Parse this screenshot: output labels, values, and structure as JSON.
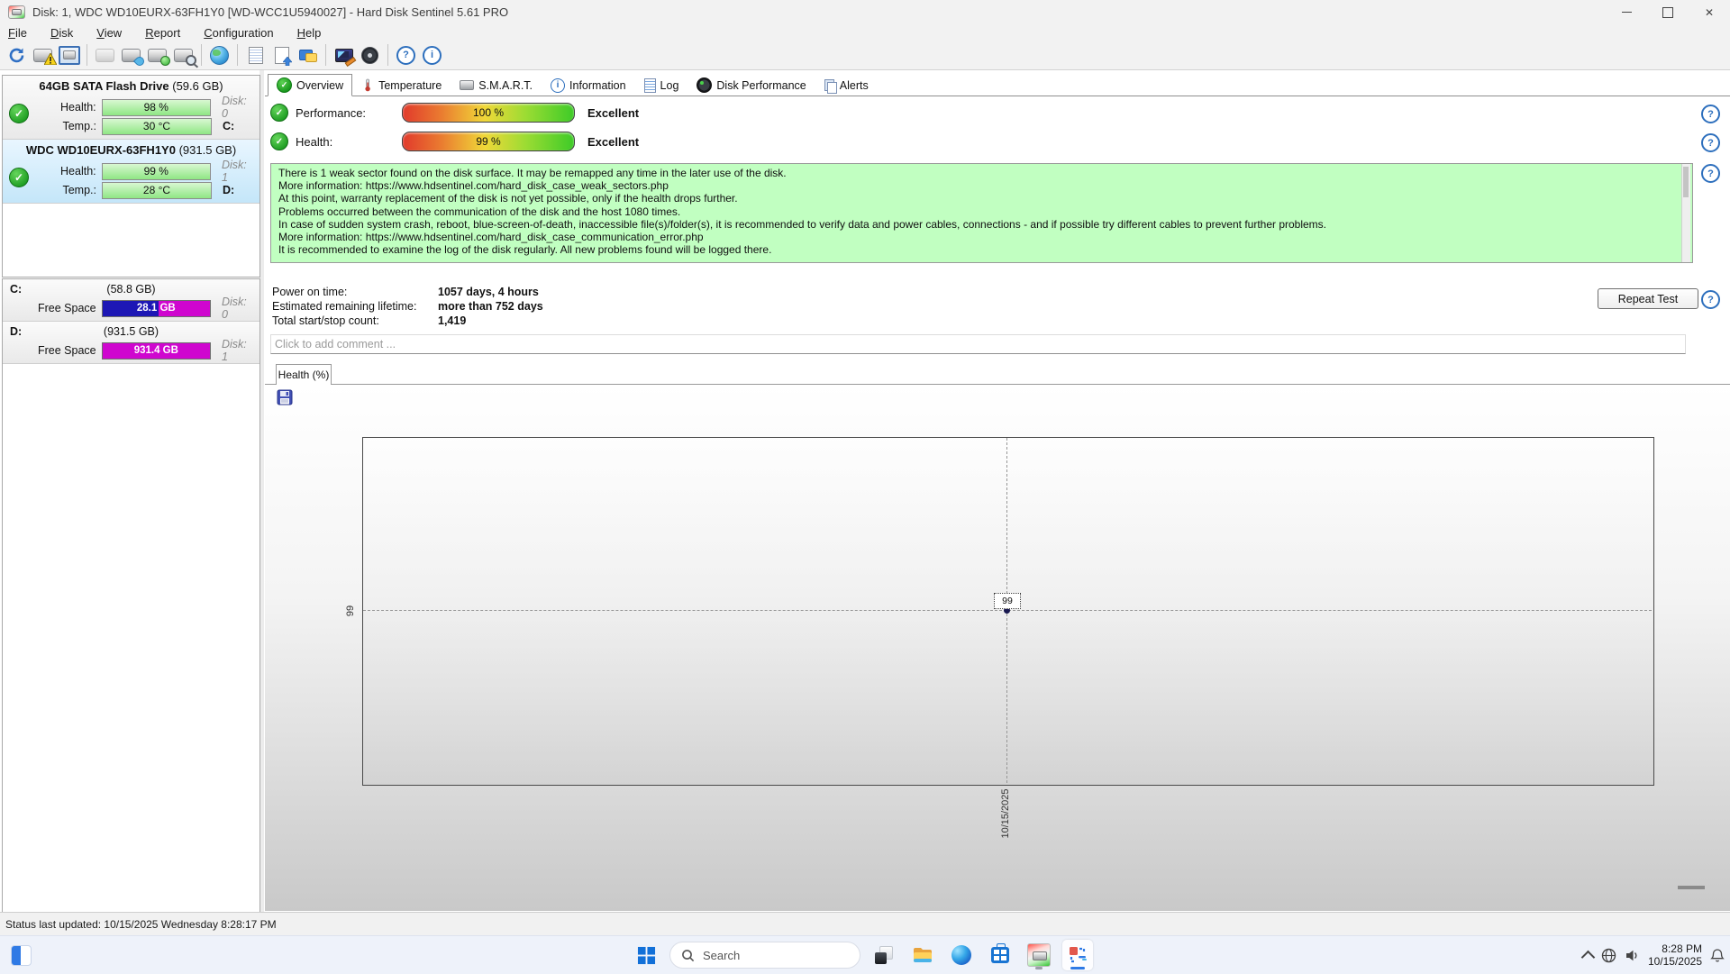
{
  "icons": {
    "close": "✕",
    "check": "✓",
    "help": "?",
    "info": "i",
    "refresh_alt": "⟳"
  },
  "window": {
    "title": "Disk: 1, WDC WD10EURX-63FH1Y0 [WD-WCC1U5940027]  -  Hard Disk Sentinel 5.61 PRO"
  },
  "menu": {
    "items": [
      "File",
      "Disk",
      "View",
      "Report",
      "Configuration",
      "Help"
    ]
  },
  "sidebar": {
    "labels": {
      "health": "Health:",
      "temp": "Temp.:",
      "free": "Free Space"
    },
    "disks": [
      {
        "name": "64GB SATA Flash Drive",
        "size": "(59.6 GB)",
        "health": "98 %",
        "temp": "30 °C",
        "disk": "Disk: 0",
        "drive": "C:"
      },
      {
        "name": "WDC WD10EURX-63FH1Y0",
        "size": "(931.5 GB)",
        "health": "99 %",
        "temp": "28 °C",
        "disk": "Disk: 1",
        "drive": "D:"
      }
    ],
    "partitions": [
      {
        "letter": "C:",
        "size": "(58.8 GB)",
        "free": "28.1 GB",
        "disk": "Disk: 0",
        "used_pct": 52
      },
      {
        "letter": "D:",
        "size": "(931.5 GB)",
        "free": "931.4 GB",
        "disk": "Disk: 1",
        "used_pct": 0
      }
    ]
  },
  "tabs": {
    "items": [
      {
        "label": "Overview"
      },
      {
        "label": "Temperature"
      },
      {
        "label": "S.M.A.R.T."
      },
      {
        "label": "Information"
      },
      {
        "label": "Log"
      },
      {
        "label": "Disk Performance"
      },
      {
        "label": "Alerts"
      }
    ]
  },
  "overview": {
    "performance": {
      "label": "Performance:",
      "value": "100 %",
      "rating": "Excellent",
      "pct": 100
    },
    "health": {
      "label": "Health:",
      "value": "99 %",
      "rating": "Excellent",
      "pct": 99
    },
    "message_lines": [
      "There is 1 weak sector found on the disk surface. It may be remapped any time in the later use of the disk.",
      "More information: https://www.hdsentinel.com/hard_disk_case_weak_sectors.php",
      "At this point, warranty replacement of the disk is not yet possible, only if the health drops further.",
      "Problems occurred between the communication of the disk and the host 1080 times.",
      "In case of sudden system crash, reboot, blue-screen-of-death, inaccessible file(s)/folder(s), it is recommended to verify data and power cables, connections - and if possible try different cables to prevent further problems.",
      "More information: https://www.hdsentinel.com/hard_disk_case_communication_error.php",
      "It is recommended to examine the log of the disk regularly. All new problems found will be logged there."
    ],
    "stats": [
      {
        "label": "Power on time:",
        "value": "1057 days, 4 hours"
      },
      {
        "label": "Estimated remaining lifetime:",
        "value": "more than 752 days"
      },
      {
        "label": "Total start/stop count:",
        "value": "1,419"
      }
    ],
    "repeat_test_label": "Repeat Test",
    "comment_placeholder": "Click to add comment ..."
  },
  "chart": {
    "tab_label": "Health (%)",
    "chart_data": {
      "type": "line",
      "title": "Health (%)",
      "x": [
        "10/15/2025"
      ],
      "series": [
        {
          "name": "Health",
          "values": [
            99
          ]
        }
      ],
      "point_labels": [
        "99"
      ],
      "y_axis_tick": "99",
      "x_axis_tick": "10/15/2025",
      "grid": "dashed-crosshair",
      "legend": "none"
    }
  },
  "status_bar": {
    "text": "Status last updated: 10/15/2025 Wednesday 8:28:17 PM"
  },
  "taskbar": {
    "search_placeholder": "Search",
    "clock": {
      "time": "8:28 PM",
      "date": "10/15/2025"
    }
  },
  "colors": {
    "message_bg": "#c1ffc1",
    "health_bar_green": "#8fe684",
    "free_space_magenta": "#cf06cf",
    "used_space_blue": "#1d17b5",
    "selected_disk_bg": "#c4e6f9",
    "grad_bar": [
      "#e13a2c",
      "#f0d838",
      "#3ecb28"
    ],
    "taskbar_accent": "#2f7ae5"
  }
}
